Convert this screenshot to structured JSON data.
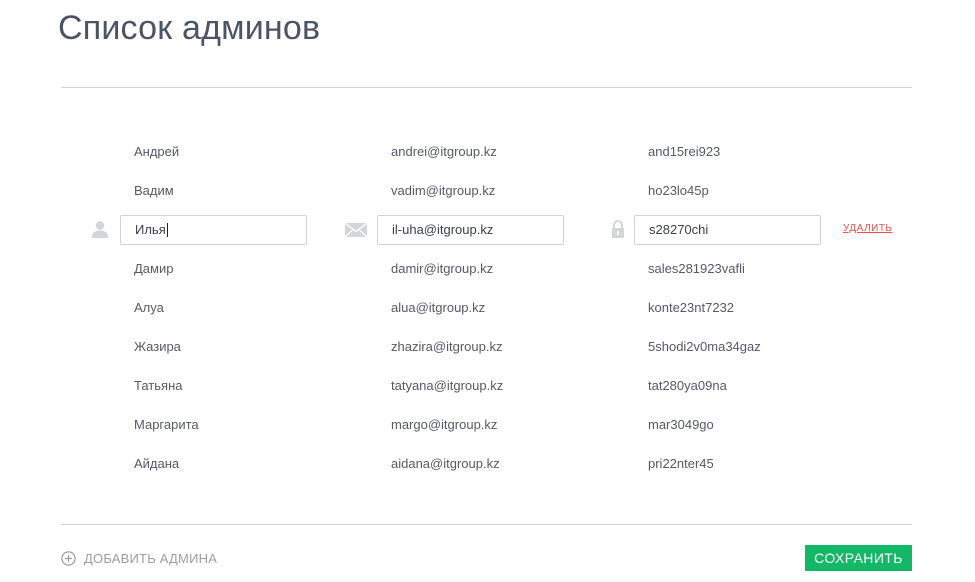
{
  "page": {
    "title": "Список админов"
  },
  "admins": [
    {
      "name": "Андрей",
      "email": "andrei@itgroup.kz",
      "password": "and15rei923"
    },
    {
      "name": "Вадим",
      "email": "vadim@itgroup.kz",
      "password": "ho23lo45p"
    },
    {
      "name": "Илья",
      "email": "il-uha@itgroup.kz",
      "password": "s28270chi"
    },
    {
      "name": "Дамир",
      "email": "damir@itgroup.kz",
      "password": "sales281923vafli"
    },
    {
      "name": "Алуа",
      "email": "alua@itgroup.kz",
      "password": "konte23nt7232"
    },
    {
      "name": "Жазира",
      "email": "zhazira@itgroup.kz",
      "password": "5shodi2v0ma34gaz"
    },
    {
      "name": "Татьяна",
      "email": "tatyana@itgroup.kz",
      "password": "tat280ya09na"
    },
    {
      "name": "Маргарита",
      "email": "margo@itgroup.kz",
      "password": "mar3049go"
    },
    {
      "name": "Айдана",
      "email": "aidana@itgroup.kz",
      "password": "pri22nter45"
    }
  ],
  "editing": {
    "delete_label": "УДАЛИТЬ"
  },
  "footer": {
    "add_admin_label": "ДОБАВИТЬ АДМИНА",
    "save_label": "СОХРАНИТЬ"
  },
  "colors": {
    "accent": "#13b866",
    "danger": "#e8504a",
    "title": "#4c5365"
  },
  "icons": {
    "name_field": "user-icon",
    "email_field": "mail-icon",
    "password_field": "lock-icon",
    "add": "plus-circle-icon"
  }
}
